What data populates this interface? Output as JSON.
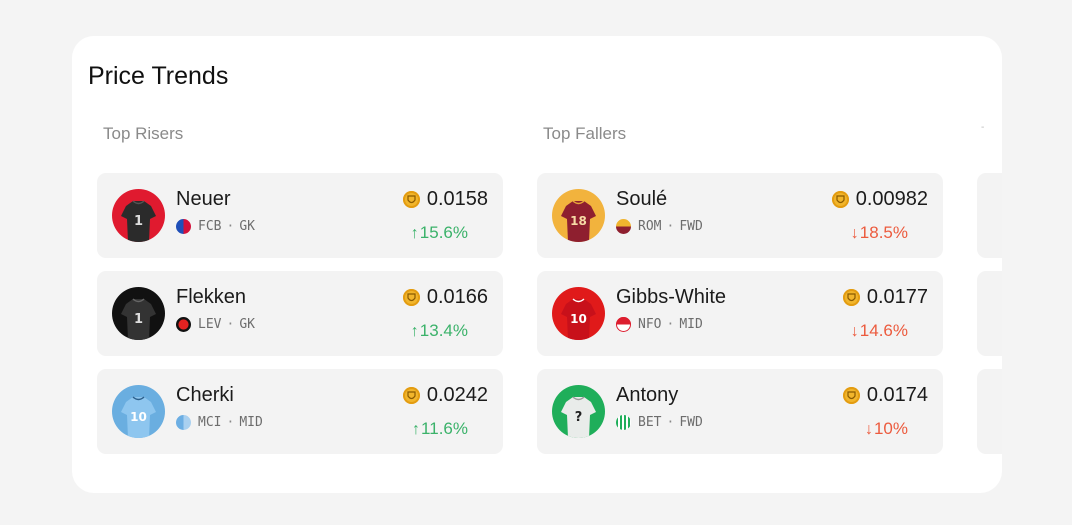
{
  "title": "Price Trends",
  "columns": {
    "risers": {
      "heading": "Top Risers",
      "players": [
        {
          "name": "Neuer",
          "club": "FCB",
          "position": "GK",
          "price": "0.0158",
          "change": "15.6%"
        },
        {
          "name": "Flekken",
          "club": "LEV",
          "position": "GK",
          "price": "0.0166",
          "change": "13.4%"
        },
        {
          "name": "Cherki",
          "club": "MCI",
          "position": "MID",
          "price": "0.0242",
          "change": "11.6%"
        }
      ]
    },
    "fallers": {
      "heading": "Top Fallers",
      "players": [
        {
          "name": "Soulé",
          "club": "ROM",
          "position": "FWD",
          "price": "0.00982",
          "change": "18.5%"
        },
        {
          "name": "Gibbs-White",
          "club": "NFO",
          "position": "MID",
          "price": "0.0177",
          "change": "14.6%"
        },
        {
          "name": "Antony",
          "club": "BET",
          "position": "FWD",
          "price": "0.0174",
          "change": "10%"
        }
      ]
    }
  },
  "meta_separator": "·",
  "arrows": {
    "up": "↑",
    "down": "↓"
  },
  "colors": {
    "up": "#3bb26a",
    "down": "#ec5b3e",
    "coin": "#f1b52b"
  }
}
